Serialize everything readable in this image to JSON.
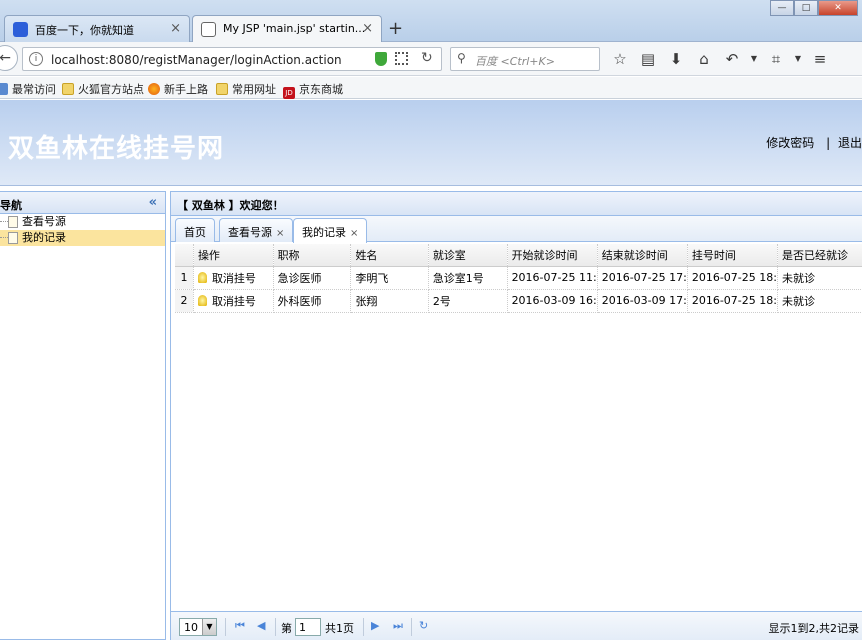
{
  "browser": {
    "tabs": [
      {
        "title": "百度一下，你就知道",
        "icon": "baidu-paw-icon"
      },
      {
        "title": "My JSP 'main.jsp' startin...",
        "icon": "page-icon"
      }
    ],
    "url": "localhost:8080/registManager/loginAction.action",
    "search_placeholder": "百度 <Ctrl+K>",
    "bookmarks": [
      "最常访问",
      "火狐官方站点",
      "新手上路",
      "常用网址",
      "京东商城"
    ]
  },
  "app": {
    "title": "双鱼林在线挂号网",
    "links": {
      "change_password": "修改密码",
      "separator": "|",
      "logout": "退出"
    },
    "nav": {
      "title": "导航",
      "items": [
        "查看号源",
        "我的记录"
      ]
    },
    "welcome": "【 双鱼林 】欢迎您！",
    "tabs": [
      {
        "label": "首页",
        "closable": false
      },
      {
        "label": "查看号源",
        "closable": true
      },
      {
        "label": "我的记录",
        "closable": true
      }
    ],
    "grid": {
      "columns": [
        "操作",
        "职称",
        "姓名",
        "就诊室",
        "开始就诊时间",
        "结束就诊时间",
        "挂号时间",
        "是否已经就诊"
      ],
      "rows": [
        {
          "num": "1",
          "action": "取消挂号",
          "title": "急诊医师",
          "name": "李明飞",
          "room": "急诊室1号",
          "start": "2016-07-25 11:",
          "end": "2016-07-25 17:",
          "reg": "2016-07-25 18:",
          "visited": "未就诊"
        },
        {
          "num": "2",
          "action": "取消挂号",
          "title": "外科医师",
          "name": "张翔",
          "room": "2号",
          "start": "2016-03-09 16:",
          "end": "2016-03-09 17:",
          "reg": "2016-07-25 18:",
          "visited": "未就诊"
        }
      ]
    },
    "pager": {
      "page_size": "10",
      "page_prefix": "第",
      "page_value": "1",
      "page_suffix": "共1页",
      "info": "显示1到2,共2记录"
    }
  }
}
